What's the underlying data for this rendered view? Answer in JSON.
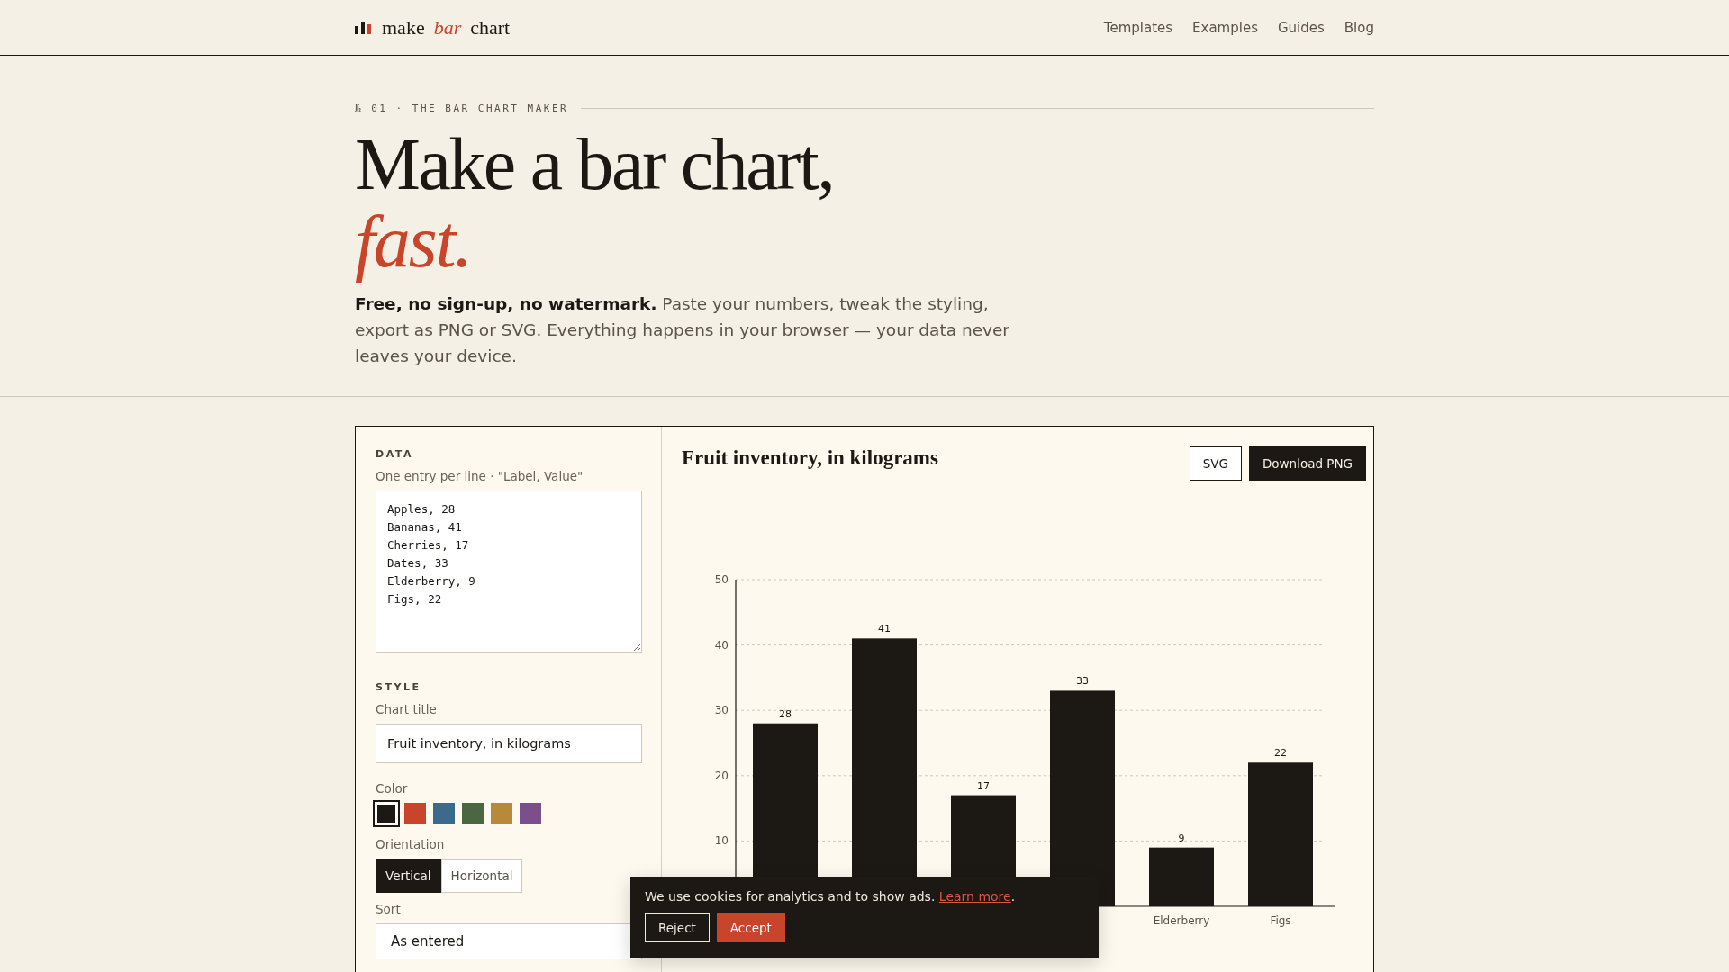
{
  "brand": {
    "parts": [
      "make",
      "bar",
      "chart"
    ]
  },
  "nav": [
    "Templates",
    "Examples",
    "Guides",
    "Blog"
  ],
  "hero": {
    "eyebrow": "№ 01 · THE BAR CHART MAKER",
    "title": "Make a bar chart,",
    "title_accent": "fast.",
    "lead": "**Free, no sign-up, no watermark.** Paste your numbers, tweak the styling, export as PNG or SVG. Everything happens in your browser — your data never leaves your device."
  },
  "editor": {
    "data_heading": "DATA",
    "data_hint": "One entry per line · \"Label, Value\"",
    "entries": [
      "Apples, 28",
      "Bananas, 41",
      "Cherries, 17",
      "Dates, 33",
      "Elderberry, 9",
      "Figs, 22"
    ],
    "style_heading": "STYLE",
    "title_label": "Chart title",
    "title_value": "Fruit inventory, in kilograms",
    "color_label": "Color",
    "colors": [
      {
        "color": "#1c1814",
        "selected": true
      },
      {
        "color": "#c8442a",
        "selected": false
      },
      {
        "color": "#3a6a8c",
        "selected": false
      },
      {
        "color": "#4a6741",
        "selected": false
      },
      {
        "color": "#b8893a",
        "selected": false
      },
      {
        "color": "#7a4f8c",
        "selected": false
      }
    ],
    "orientation_label": "Orientation",
    "orientations": [
      {
        "label": "Vertical",
        "selected": true
      },
      {
        "label": "Horizontal",
        "selected": false
      }
    ],
    "sort_label": "Sort",
    "sort_value": "As entered"
  },
  "preview": {
    "title": "Fruit inventory, in kilograms",
    "buttons": [
      {
        "label": "SVG",
        "kind": "outline"
      },
      {
        "label": "Download PNG",
        "kind": "solid"
      }
    ],
    "chart_data": {
      "type": "bar",
      "categories": [
        null,
        null,
        null,
        null,
        "Elderberry",
        "Figs"
      ],
      "values": [
        28,
        41,
        17,
        33,
        9,
        22
      ],
      "ylim": [
        0,
        50
      ],
      "yticks": [
        10,
        20,
        30,
        40,
        50
      ],
      "grid": true,
      "data_labels": true
    }
  },
  "cookie": {
    "text": "We use cookies for analytics and to show ads.",
    "link": "Learn more",
    "end": ".",
    "buttons": [
      {
        "label": "Reject",
        "kind": "outline"
      },
      {
        "label": "Accept",
        "kind": "accent"
      }
    ]
  }
}
